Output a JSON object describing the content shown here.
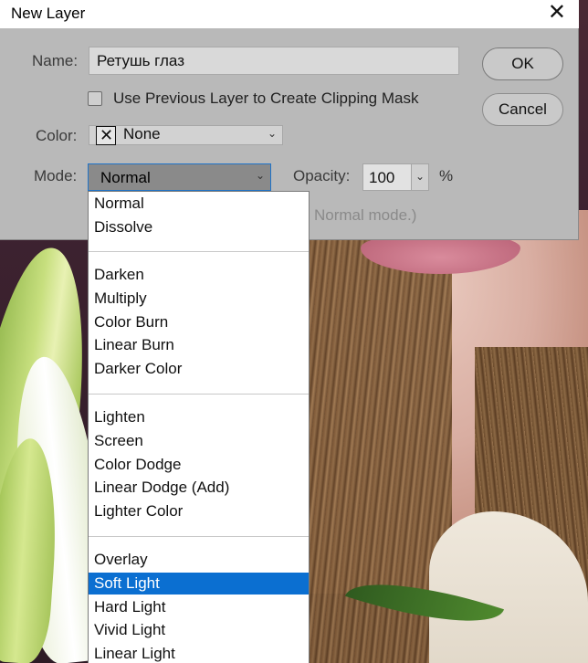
{
  "dialog": {
    "title": "New Layer",
    "name_label": "Name:",
    "name_value": "Ретушь глаз",
    "clip_label": "Use Previous Layer to Create Clipping Mask",
    "color_label": "Color:",
    "color_value": "None",
    "mode_label": "Mode:",
    "mode_value": "Normal",
    "opacity_label": "Opacity:",
    "opacity_value": "100",
    "opacity_unit": "%",
    "hint_text": "Normal mode.)",
    "ok_label": "OK",
    "cancel_label": "Cancel"
  },
  "mode_groups": [
    [
      "Normal",
      "Dissolve"
    ],
    [
      "Darken",
      "Multiply",
      "Color Burn",
      "Linear Burn",
      "Darker Color"
    ],
    [
      "Lighten",
      "Screen",
      "Color Dodge",
      "Linear Dodge (Add)",
      "Lighter Color"
    ],
    [
      "Overlay",
      "Soft Light",
      "Hard Light",
      "Vivid Light",
      "Linear Light"
    ]
  ],
  "highlighted_option": "Soft Light",
  "colors": {
    "dialog_bg": "#b9b9b9",
    "highlight": "#0b6fd1",
    "focus_border": "#1f73c8"
  }
}
